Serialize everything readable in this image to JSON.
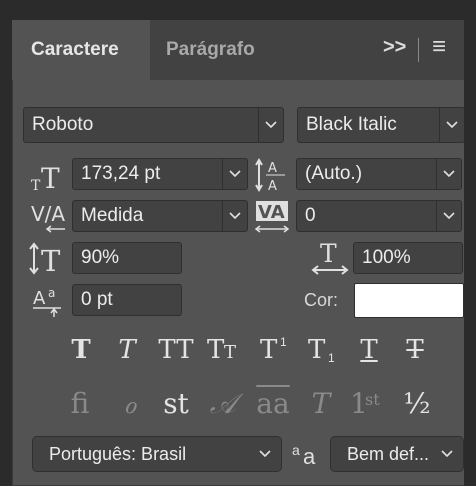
{
  "tabs": {
    "active": "Caractere",
    "inactive": "Parágrafo"
  },
  "panel_menu": {
    "expand": ">>",
    "menu": "≡"
  },
  "font": {
    "family": "Roboto",
    "style": "Black Italic"
  },
  "size": {
    "font_size": "173,24 pt",
    "leading": "(Auto.)"
  },
  "spacing": {
    "kerning": "Medida",
    "tracking": "0"
  },
  "scale": {
    "vertical": "90%",
    "horizontal": "100%"
  },
  "baseline": {
    "shift": "0 pt",
    "color_label": "Cor:"
  },
  "type_styles": {
    "bold": "T",
    "italic": "T",
    "all_caps": "TT",
    "small_caps_big": "T",
    "small_caps_small": "T",
    "superscript": "T",
    "superscript_mark": "1",
    "subscript": "T",
    "subscript_mark": "1",
    "underline": "T",
    "strikethrough": "T"
  },
  "opentype": {
    "ligatures": "fi",
    "old_style": "ℴ",
    "discretionary": "st",
    "swash": "𝒜",
    "titling": "aa",
    "contextual": "T",
    "ordinals": "1",
    "ordinals_sup": "st",
    "fractions": "½"
  },
  "language": {
    "value": "Português: Brasil",
    "aa_icon": "a",
    "aa_icon_small": "a",
    "antialias": "Bem def..."
  },
  "colors": {
    "swatch": "#ffffff",
    "panel": "#535353"
  }
}
